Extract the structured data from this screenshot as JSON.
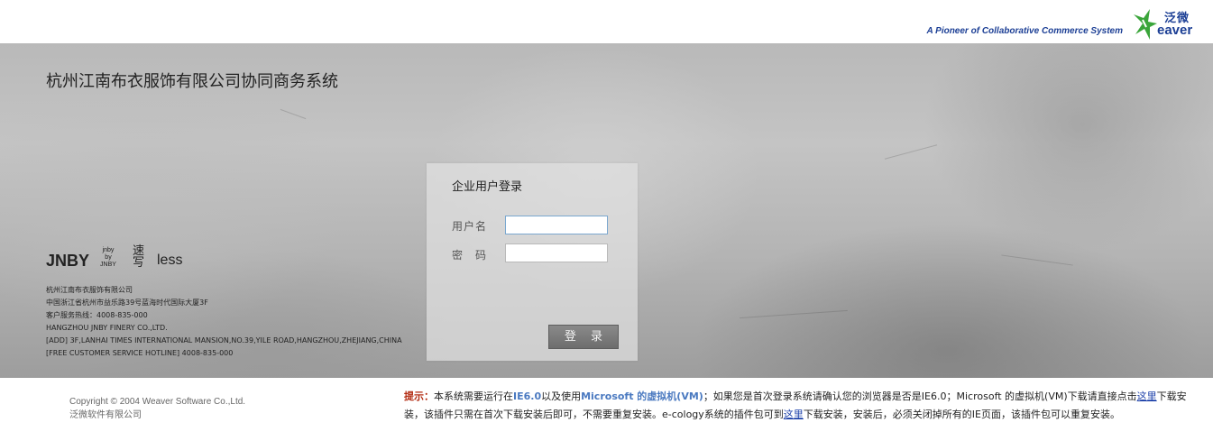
{
  "header": {
    "tagline": "A Pioneer of Collaborative Commerce System",
    "logo_cn": "泛微",
    "logo_en": "eaver",
    "logo_color": "#1c3f95",
    "logo_mark_color": "#3aa53a"
  },
  "main": {
    "system_title": "杭州江南布衣服饰有限公司协同商务系统",
    "brands": {
      "jnby": "JNBY",
      "jnby_by_jnby": [
        "jnby",
        "by",
        "JNBY"
      ],
      "seal": "速写",
      "less": "less"
    },
    "company_info": [
      "杭州江南布衣服饰有限公司",
      "中国浙江省杭州市益乐路39号蓝海时代国际大厦3F",
      "客户服务热线：4008-835-000",
      "HANGZHOU JNBY FINERY CO.,LTD.",
      "[ADD] 3F,LANHAI TIMES INTERNATIONAL MANSION,NO.39,YILE ROAD,HANGZHOU,ZHEJIANG,CHINA",
      "[FREE CUSTOMER SERVICE HOTLINE] 4008-835-000"
    ]
  },
  "login": {
    "title": "企业用户登录",
    "username_label": "用户名",
    "username_value": "",
    "password_label": "密　码",
    "password_value": "",
    "submit_label": "登 录"
  },
  "footer": {
    "copyright": "Copyright © 2004 Weaver Software Co.,Ltd.",
    "company": "泛微软件有限公司",
    "notice": {
      "tip_label": "提示：",
      "part1": "本系统需要运行在",
      "ie": "IE6.0",
      "part2": "以及使用",
      "vm": "Microsoft 的虚拟机(VM)",
      "part3": "；如果您是首次登录系统请确认您的浏览器是否是IE6.0；Microsoft 的虚拟机(VM)下载请直接点击",
      "link1": "这里",
      "part4": "下载安装，该插件只需在首次下载安装后即可，不需要重复安装。e-cology系统的插件包可到",
      "link2": "这里",
      "part5": "下载安装，安装后，必须关闭掉所有的IE页面，该插件包可以重复安装。"
    }
  }
}
